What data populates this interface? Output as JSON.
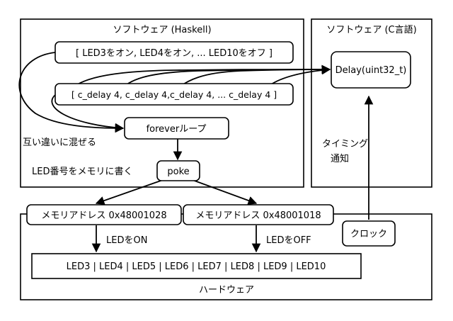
{
  "frames": {
    "software_haskell": "ソフトウェア (Haskell)",
    "software_c": "ソフトウェア (C言語)",
    "hardware": "ハードウェア"
  },
  "nodes": {
    "led_list": "[ LED3をオン, LED4をオン, ... LED10をオフ ]",
    "delay_list": "[ c_delay 4, c_delay 4,c_delay 4, ... c_delay 4 ]",
    "forever_loop": "foreverループ",
    "poke": "poke",
    "delay_func": "Delay(uint32_t)",
    "mem_on": "メモリアドレス 0x48001028",
    "mem_off": "メモリアドレス 0x48001018",
    "clock": "クロック",
    "leds": "LED3 | LED4 | LED5 | LED6 | LED7 | LED8 | LED9 | LED10"
  },
  "labels": {
    "mix": "互い違いに混ぜる",
    "write_led": "LED番号をメモリに書く",
    "timing_line1": "タイミング",
    "timing_line2": "通知",
    "led_on": "LEDをON",
    "led_off": "LEDをOFF"
  }
}
